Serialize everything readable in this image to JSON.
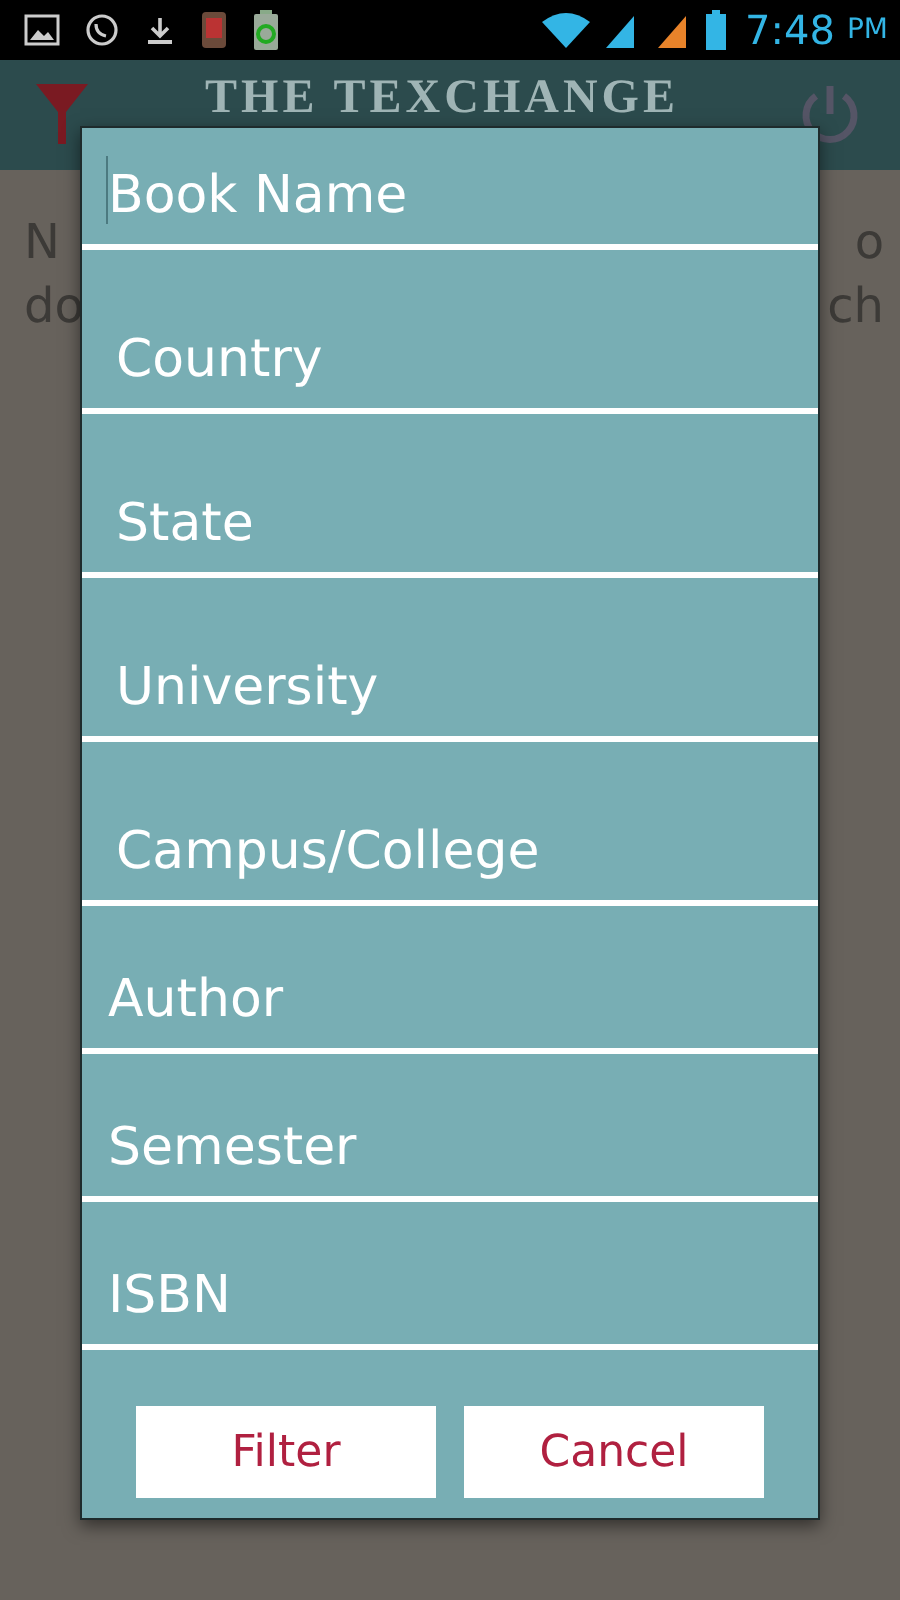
{
  "status_bar": {
    "time": "7:48",
    "meridiem": "PM"
  },
  "app_bar": {
    "title": "THE TEXCHANGE"
  },
  "background_message": {
    "left": [
      "N",
      "do"
    ],
    "right": [
      "o",
      "ch"
    ]
  },
  "dialog": {
    "fields": [
      {
        "placeholder": "Book Name",
        "focused": true
      },
      {
        "placeholder": "Country",
        "focused": false
      },
      {
        "placeholder": "State",
        "focused": false
      },
      {
        "placeholder": "University",
        "focused": false
      },
      {
        "placeholder": "Campus/College",
        "focused": false
      },
      {
        "placeholder": "Author",
        "focused": false
      },
      {
        "placeholder": "Semester",
        "focused": false
      },
      {
        "placeholder": "ISBN",
        "focused": false
      }
    ],
    "buttons": [
      "Filter",
      "Cancel"
    ]
  }
}
